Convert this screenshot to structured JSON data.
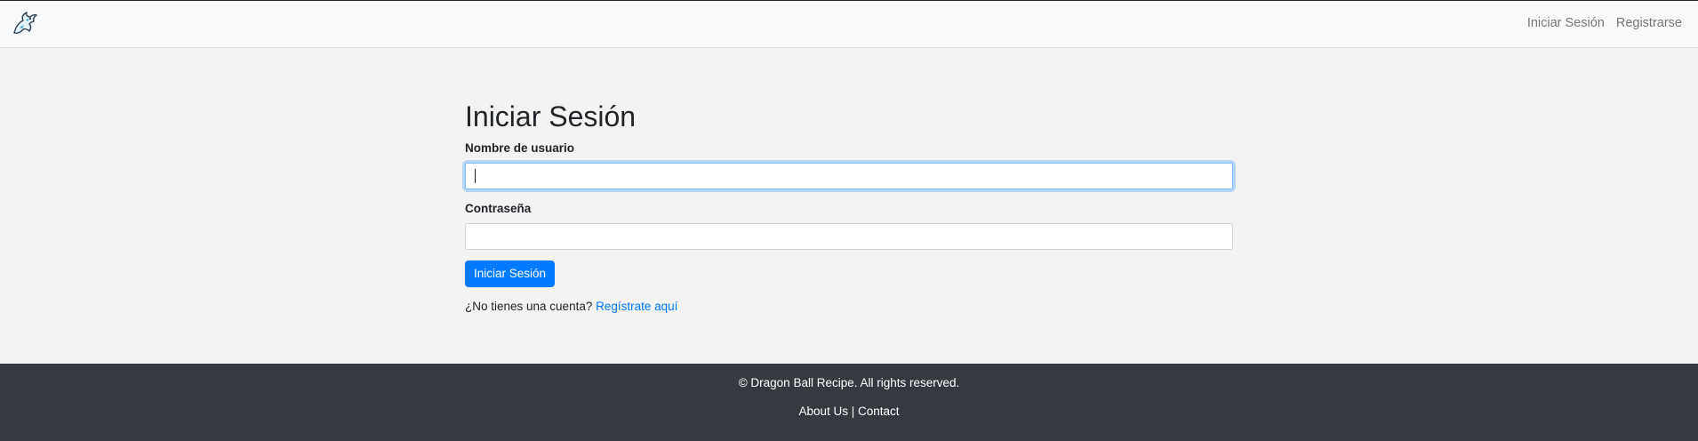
{
  "navbar": {
    "logo_icon": "dragon-logo-icon",
    "links": {
      "login": "Iniciar Sesión",
      "register": "Registrarse"
    }
  },
  "form": {
    "title": "Iniciar Sesión",
    "username_label": "Nombre de usuario",
    "username_value": "",
    "password_label": "Contraseña",
    "password_value": "",
    "submit_label": "Iniciar Sesión",
    "signup_prompt": "¿No tienes una cuenta?",
    "signup_link": "Regístrate aquí"
  },
  "footer": {
    "copyright": "© Dragon Ball Recipe. All rights reserved.",
    "about_link": "About Us",
    "separator": "|",
    "contact_link": "Contact"
  },
  "colors": {
    "primary": "#007bff",
    "footer_bg": "#343a40",
    "navbar_bg": "#f8f9fa",
    "page_bg": "#f3f3f3"
  }
}
